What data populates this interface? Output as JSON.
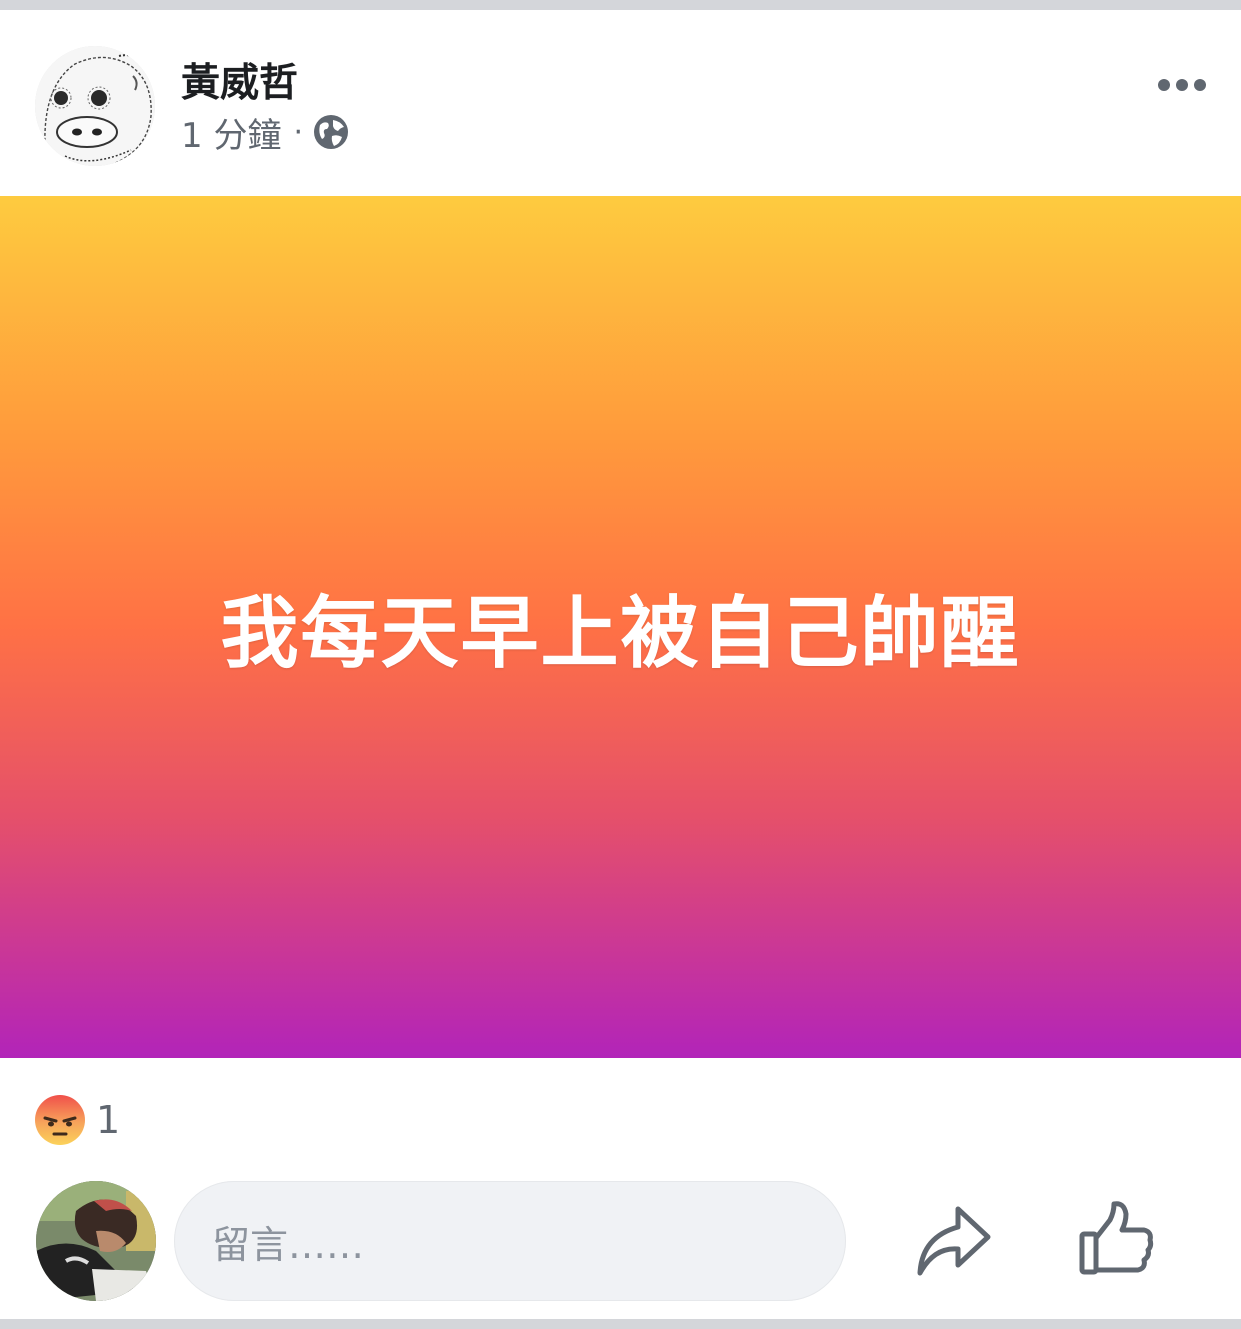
{
  "post": {
    "author": "黃威哲",
    "time": "1 分鐘",
    "separator": "·",
    "privacy_icon": "globe-icon",
    "more_icon": "more-options-icon",
    "background_gradient": [
      "#fecb3f",
      "#ff7145",
      "#b224b9"
    ],
    "text": "我每天早上被自己帥醒"
  },
  "reactions": {
    "icon": "angry-reaction-icon",
    "count": "1"
  },
  "comment": {
    "placeholder": "留言……",
    "share_icon": "share-arrow-icon",
    "like_icon": "thumbs-up-icon"
  }
}
